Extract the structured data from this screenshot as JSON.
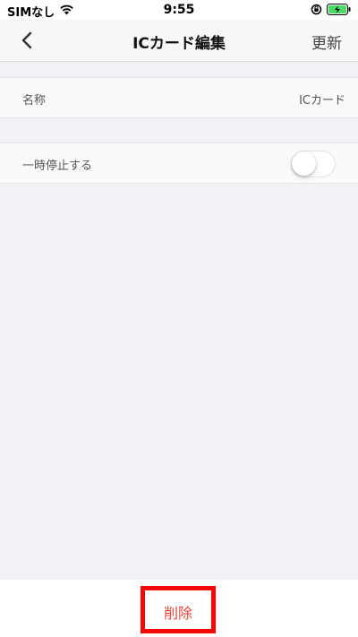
{
  "status_bar": {
    "carrier": "SIMなし",
    "time": "9:55"
  },
  "nav": {
    "title": "ICカード編集",
    "action_label": "更新"
  },
  "rows": {
    "name": {
      "label": "名称",
      "value": "ICカード"
    },
    "pause": {
      "label": "一時停止する",
      "toggle_on": false
    }
  },
  "bottom": {
    "delete_label": "削除"
  },
  "colors": {
    "background": "#f2f2f6",
    "delete_text": "#e8463c",
    "highlight_box": "#ff0000",
    "battery": "#4cd964"
  },
  "icons": {
    "wifi": "wifi-icon",
    "orientation_lock": "orientation-lock-icon",
    "battery": "battery-charging-icon",
    "back": "chevron-left-icon"
  }
}
